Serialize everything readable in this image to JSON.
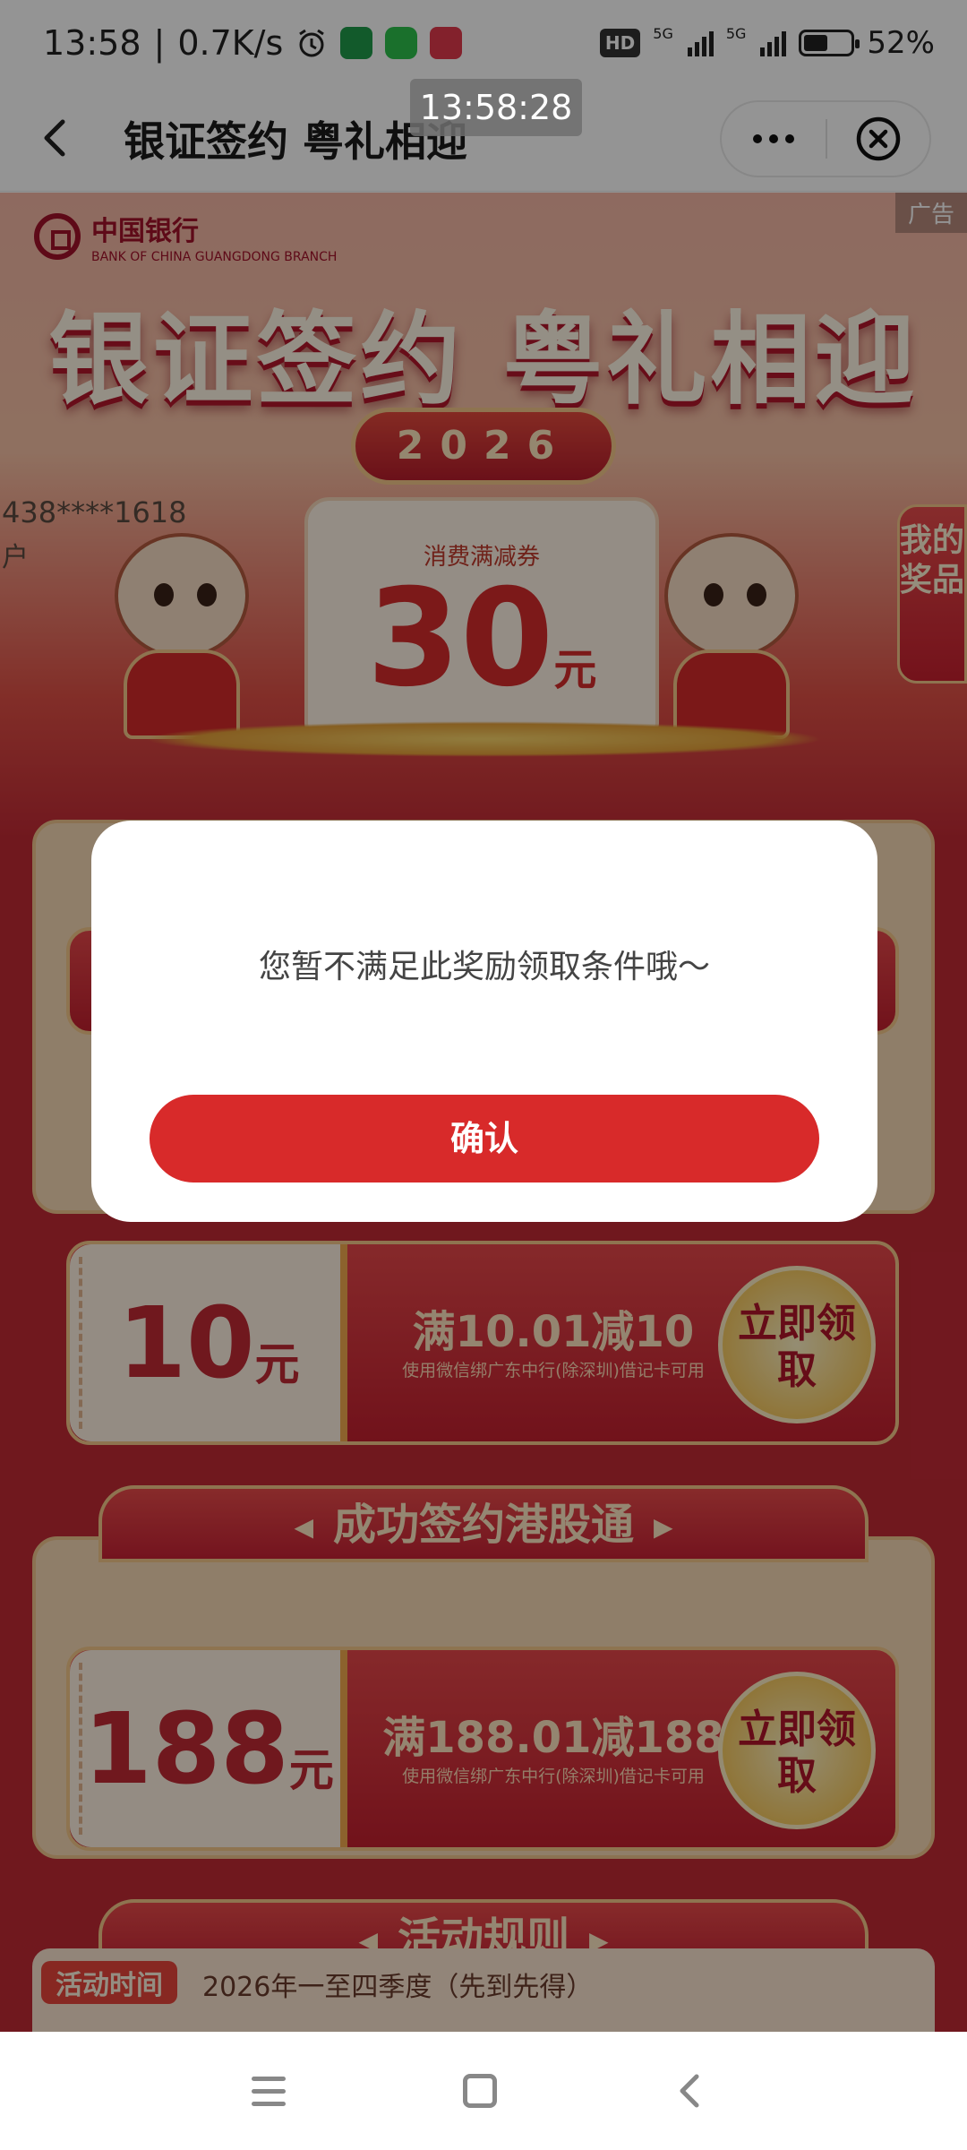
{
  "status_bar": {
    "time": "13:58",
    "speed": "0.7K/s",
    "network_badge": "HD",
    "signal1_label": "5G",
    "signal2_label": "5G",
    "battery": "52%",
    "battery_level": 0.52
  },
  "nav": {
    "title": "银证签约 粤礼相迎"
  },
  "time_toast": "13:58:28",
  "hero": {
    "ad_label": "广告",
    "bank_name": "中国银行",
    "bank_en": "BANK OF CHINA  GUANGDONG BRANCH",
    "title": "银证签约 粤礼相迎",
    "year": "2026",
    "account_mask": "438****1618",
    "account_sub": "户",
    "prize_label": "消费满减券",
    "prize_amount": "30",
    "prize_unit": "元",
    "side_tab": "我的奖品"
  },
  "coupons": [
    {
      "value": "10",
      "unit": "元",
      "title": "满10.01减10",
      "desc": "使用微信绑广东中行(除深圳)借记卡可用",
      "button": "立即领取"
    },
    {
      "value": "188",
      "unit": "元",
      "title": "满188.01减188",
      "desc": "使用微信绑广东中行(除深圳)借记卡可用",
      "button": "立即领取"
    }
  ],
  "sections": {
    "hk_connect": "成功签约港股通",
    "rules": "活动规则"
  },
  "rules": {
    "tag": "活动时间",
    "text": "2026年一至四季度（先到先得）"
  },
  "dialog": {
    "message": "您暂不满足此奖励领取条件哦～",
    "confirm": "确认"
  },
  "colors": {
    "accent": "#d82a2a",
    "page_bg": "#c22a35",
    "gold": "#f5c98a"
  }
}
